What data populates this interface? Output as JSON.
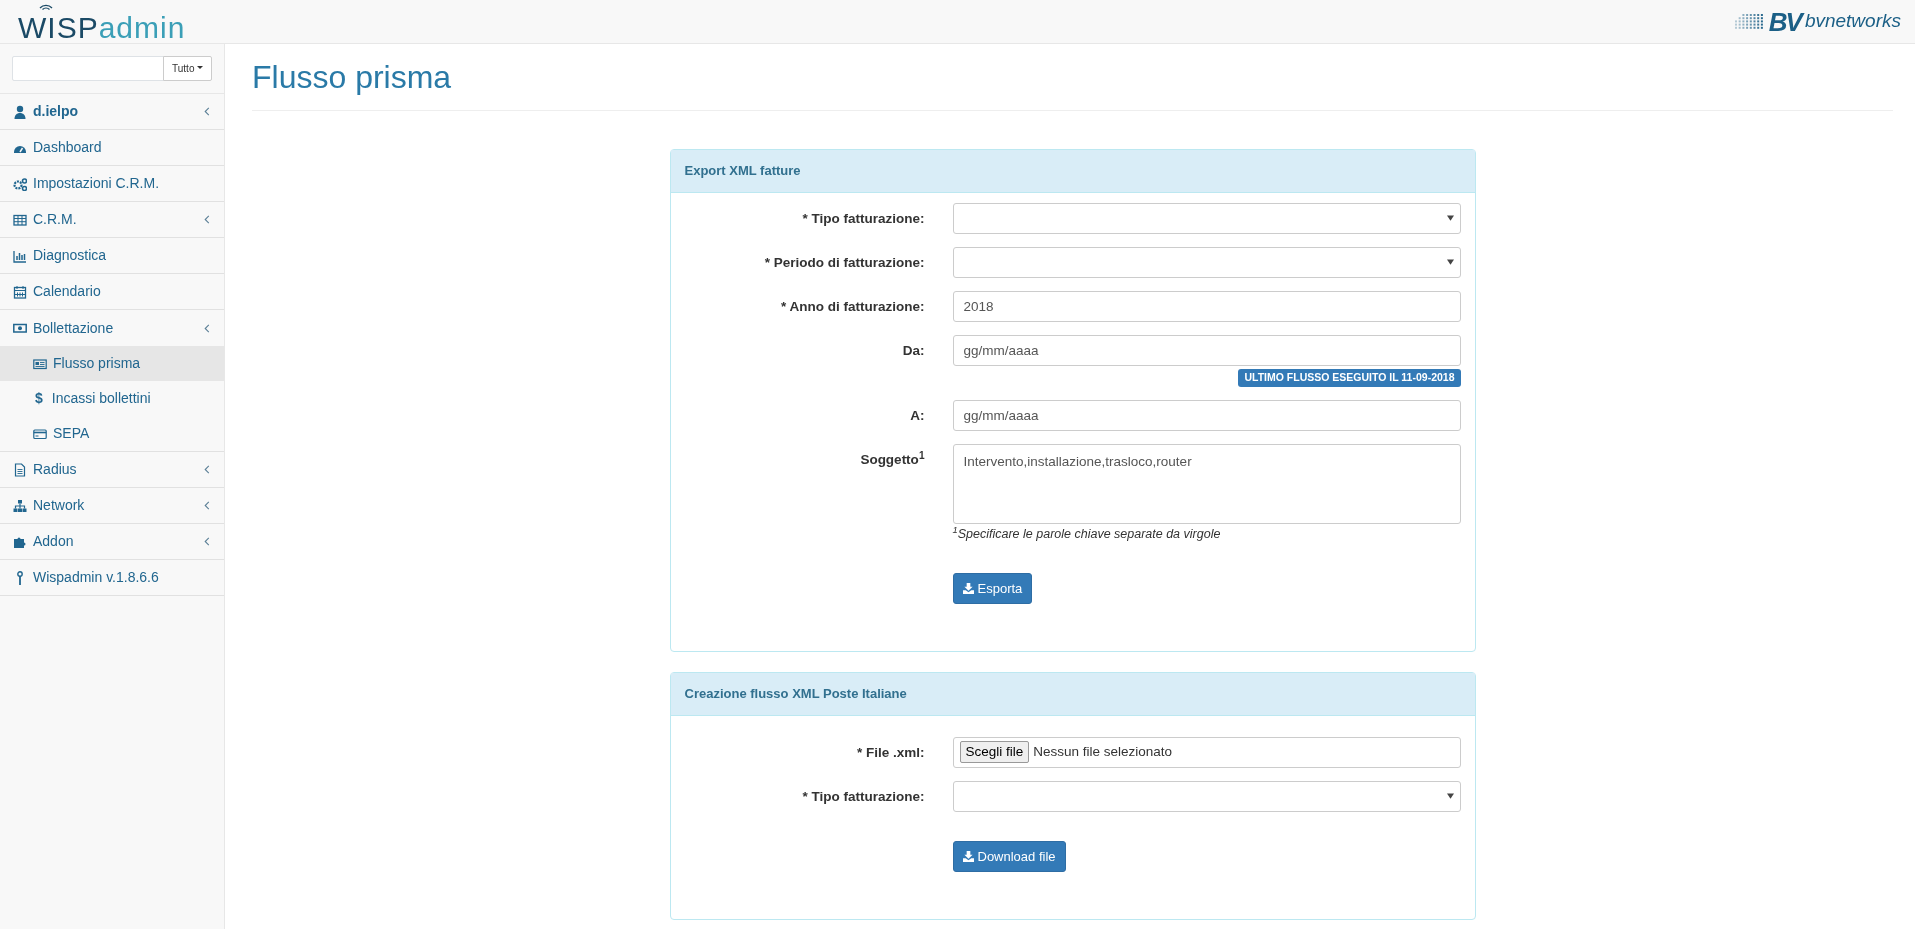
{
  "header": {
    "logo": {
      "dark": "WISP",
      "light": "admin"
    },
    "brand": {
      "mark": "BV",
      "name": "bvnetworks"
    }
  },
  "sidebar": {
    "filter": "Tutto",
    "items": [
      {
        "label": "d.ielpo",
        "kind": "user",
        "has_submenu": true,
        "selected": false
      },
      {
        "label": "Dashboard",
        "kind": "link",
        "has_submenu": false,
        "selected": false
      },
      {
        "label": "Impostazioni C.R.M.",
        "kind": "link",
        "has_submenu": false,
        "selected": false
      },
      {
        "label": "C.R.M.",
        "kind": "link",
        "has_submenu": true,
        "selected": false
      },
      {
        "label": "Diagnostica",
        "kind": "link",
        "has_submenu": false,
        "selected": false
      },
      {
        "label": "Calendario",
        "kind": "link",
        "has_submenu": false,
        "selected": false
      },
      {
        "label": "Bollettazione",
        "kind": "link",
        "has_submenu": true,
        "selected": false,
        "children": [
          {
            "label": "Flusso prisma",
            "selected": true
          },
          {
            "label": "Incassi bollettini",
            "icon_char": "$",
            "selected": false
          },
          {
            "label": "SEPA",
            "selected": false
          }
        ]
      },
      {
        "label": "Radius",
        "kind": "link",
        "has_submenu": true,
        "selected": false
      },
      {
        "label": "Network",
        "kind": "link",
        "has_submenu": true,
        "selected": false
      },
      {
        "label": "Addon",
        "kind": "link",
        "has_submenu": true,
        "selected": false
      },
      {
        "label": "Wispadmin v.1.8.6.6",
        "kind": "link",
        "has_submenu": false,
        "selected": false
      }
    ]
  },
  "page_title": "Flusso prisma",
  "panels": [
    {
      "title": "Export XML fatture",
      "button": "Esporta",
      "fields": [
        {
          "kind": "select",
          "label": "* Tipo fatturazione:"
        },
        {
          "kind": "select",
          "label": "* Periodo di fatturazione:"
        },
        {
          "kind": "text",
          "label": "* Anno di fatturazione:",
          "value": "2018"
        },
        {
          "kind": "date",
          "label": "Da:",
          "placeholder": "gg/mm/aaaa",
          "badge": "ULTIMO FLUSSO ESEGUITO IL 11-09-2018"
        },
        {
          "kind": "date",
          "label": "A:",
          "placeholder": "gg/mm/aaaa"
        },
        {
          "kind": "textarea",
          "label": "Soggetto$^{1}$",
          "value": "Intervento,installazione,trasloco,router",
          "help": "$^{1}$Specificare le parole chiave separate da virgole"
        }
      ]
    },
    {
      "title": "Creazione flusso XML Poste Italiane",
      "button": "Download file",
      "fields": [
        {
          "kind": "file",
          "label": "* File .xml:",
          "button": "Scegli file",
          "status": "Nessun file selezionato"
        },
        {
          "kind": "select",
          "label": "* Tipo fatturazione:"
        }
      ]
    }
  ]
}
